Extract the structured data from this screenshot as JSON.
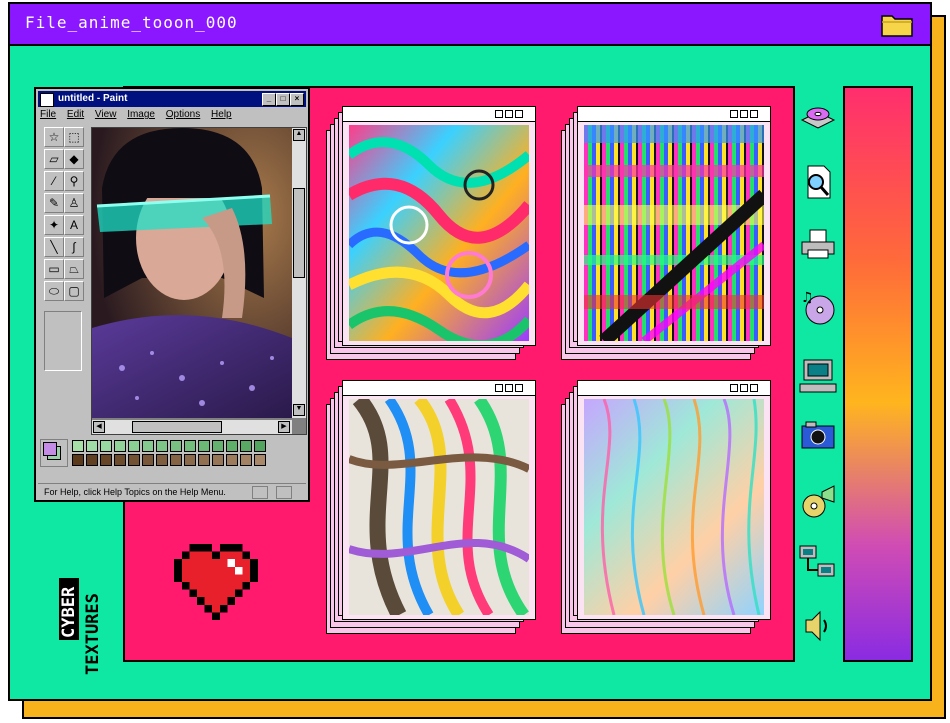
{
  "window": {
    "title": "File_anime_tooon_000",
    "accent": "#8a17ff",
    "background": "#0ee8a3",
    "shadow": "#f8b21c",
    "folder_icon": "folder-icon"
  },
  "paint": {
    "title": "untitled - Paint",
    "menu": [
      "File",
      "Edit",
      "View",
      "Image",
      "Options",
      "Help"
    ],
    "status": "For Help, click Help Topics on the Help Menu.",
    "minimize": "_",
    "maximize": "□",
    "close": "×"
  },
  "textures": [
    {
      "name": "marble-swirl-texture"
    },
    {
      "name": "pixel-glitch-texture"
    },
    {
      "name": "liquid-chrome-texture"
    },
    {
      "name": "holographic-wave-texture"
    }
  ],
  "right_icons": [
    "cd-drive-icon",
    "search-document-icon",
    "printer-icon",
    "music-cd-icon",
    "computer-icon",
    "camera-icon",
    "media-player-icon",
    "network-icon",
    "speaker-icon"
  ],
  "branding": {
    "line1": "CYBER",
    "line2": "TEXTURES"
  },
  "colors": {
    "pink_panel": "#ff1a6e",
    "heart": "#e8202b"
  }
}
